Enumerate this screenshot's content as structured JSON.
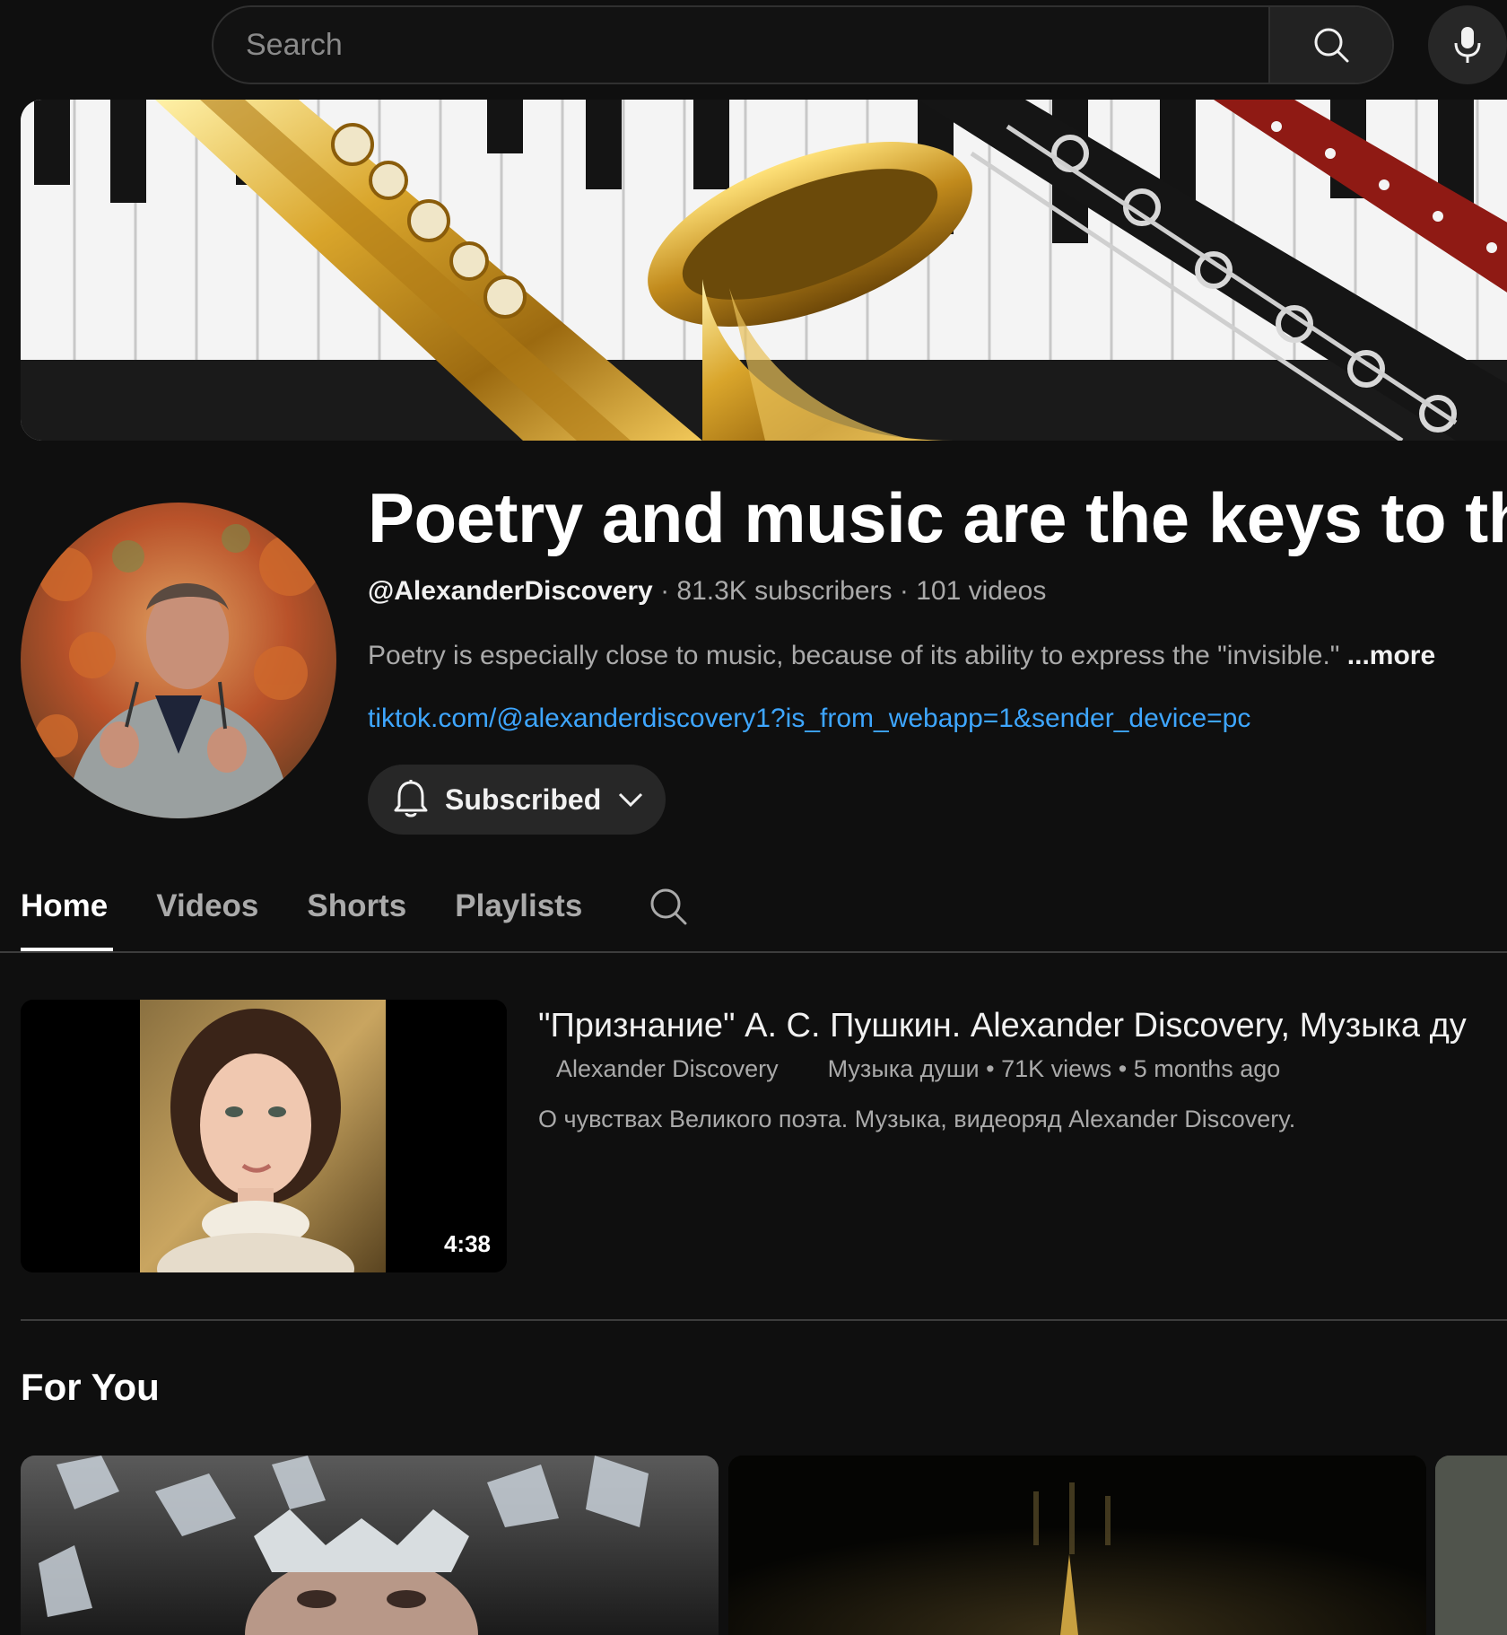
{
  "search": {
    "placeholder": "Search",
    "search_icon": "search-icon",
    "mic_icon": "mic-icon"
  },
  "channel": {
    "title": "Poetry and music are the keys to the",
    "handle": "@AlexanderDiscovery",
    "subscribers": "81.3K subscribers",
    "videos": "101 videos",
    "description": "Poetry is especially close to music, because of its ability to express the \"invisible.\"",
    "more_label": "...more",
    "link": "tiktok.com/@alexanderdiscovery1?is_from_webapp=1&sender_device=pc",
    "subscribe_label": "Subscribed"
  },
  "tabs": [
    {
      "label": "Home",
      "active": true
    },
    {
      "label": "Videos",
      "active": false
    },
    {
      "label": "Shorts",
      "active": false
    },
    {
      "label": "Playlists",
      "active": false
    }
  ],
  "featured": {
    "title": "\"Признание\" А. С. Пушкин. Alexander Discovery, Музыка ду",
    "author": "Alexander Discovery",
    "playlist": "Музыка  души",
    "views": "71K views",
    "age": "5 months ago",
    "description": "О чувствах Великого поэта. Музыка, видеоряд Alexander Discovery.",
    "duration": "4:38"
  },
  "for_you": {
    "title": "For You"
  },
  "colors": {
    "background": "#0f0f0f",
    "link": "#3ea6ff",
    "muted_text": "#aaaaaa",
    "button_bg": "#272727"
  }
}
